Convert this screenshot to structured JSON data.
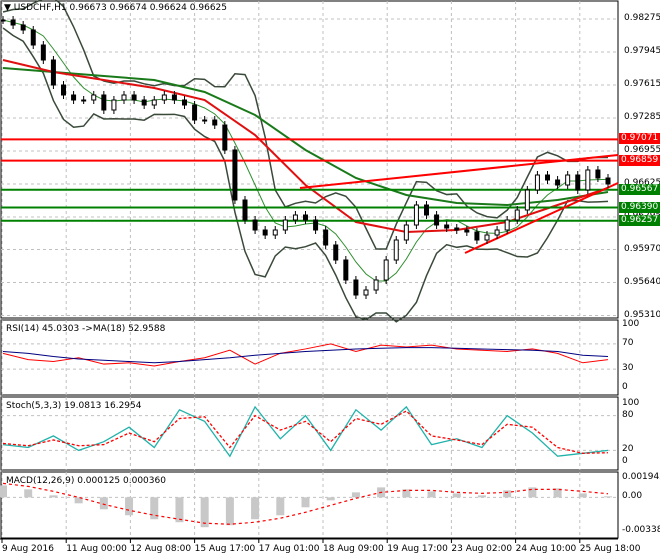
{
  "header": {
    "symbol": "USDCHF,H1",
    "open": "0.96673",
    "high": "0.96674",
    "low": "0.96624",
    "close": "0.96625"
  },
  "chart_data": [
    {
      "type": "candlestick",
      "title": "USDCHF,H1",
      "ylim": [
        0.9531,
        0.98275
      ],
      "yticks": [
        "0.98275",
        "0.97945",
        "0.97615",
        "0.97285",
        "0.96955",
        "0.96625",
        "0.96295",
        "0.95970",
        "0.95640",
        "0.95310"
      ],
      "xticks": [
        "9 Aug 2016",
        "11 Aug 00:00",
        "12 Aug 08:00",
        "15 Aug 17:00",
        "17 Aug 01:00",
        "18 Aug 09:00",
        "19 Aug 17:00",
        "23 Aug 02:00",
        "24 Aug 10:00",
        "25 Aug 18:00"
      ],
      "close": [
        0.98265,
        0.98215,
        0.98165,
        0.98015,
        0.97865,
        0.97615,
        0.97515,
        0.97465,
        0.97465,
        0.97515,
        0.97365,
        0.97465,
        0.97515,
        0.97465,
        0.97415,
        0.97465,
        0.97515,
        0.97465,
        0.97415,
        0.97265,
        0.97265,
        0.97215,
        0.96965,
        0.96465,
        0.96265,
        0.96165,
        0.96115,
        0.96165,
        0.96265,
        0.96315,
        0.96265,
        0.96165,
        0.96015,
        0.95865,
        0.95665,
        0.95515,
        0.95565,
        0.95665,
        0.95865,
        0.96065,
        0.96215,
        0.96415,
        0.96315,
        0.96215,
        0.96185,
        0.96165,
        0.96145,
        0.96065,
        0.96115,
        0.96165,
        0.96265,
        0.96365,
        0.96565,
        0.96715,
        0.96665,
        0.96615,
        0.96715,
        0.96565,
        0.96765,
        0.96685,
        0.96625
      ],
      "ma_red": [
        0.97865,
        0.97745,
        0.97665,
        0.97585,
        0.97465,
        0.97115,
        0.96615,
        0.96245,
        0.96145,
        0.96165,
        0.96245,
        0.96415,
        0.96585
      ],
      "ma_green": [
        0.97785,
        0.97745,
        0.97705,
        0.97665,
        0.97545,
        0.97315,
        0.96965,
        0.96685,
        0.96515,
        0.96435,
        0.96415,
        0.96465,
        0.96545
      ],
      "levels": [
        {
          "value": "0.97071",
          "color": "#ff0000"
        },
        {
          "value": "0.96859",
          "color": "#ff0000"
        },
        {
          "value": "0.96567",
          "color": "#008000"
        },
        {
          "value": "0.96390",
          "color": "#008000"
        },
        {
          "value": "0.96257",
          "color": "#008000"
        }
      ],
      "current_price": "0.96625"
    },
    {
      "type": "line",
      "title": "RSI(14) 45.0303  ->MA(18) 52.9588",
      "ylim": [
        0,
        100
      ],
      "yticks": [
        "100",
        "70",
        "30",
        "0"
      ],
      "series": [
        {
          "color": "#ff0000",
          "values": [
            55,
            45,
            42,
            48,
            38,
            40,
            35,
            42,
            48,
            60,
            38,
            55,
            62,
            70,
            58,
            68,
            65,
            68,
            62,
            60,
            58,
            62,
            55,
            40,
            45
          ]
        },
        {
          "color": "#000080",
          "values": [
            58,
            55,
            50,
            46,
            44,
            42,
            40,
            42,
            45,
            48,
            52,
            55,
            58,
            60,
            62,
            63,
            64,
            64,
            63,
            62,
            61,
            60,
            58,
            52,
            50
          ]
        }
      ]
    },
    {
      "type": "line",
      "title": "Stoch(5,3,3) 19.0813 16.2954",
      "ylim": [
        0,
        100
      ],
      "yticks": [
        "100",
        "80",
        "20",
        "0"
      ],
      "series": [
        {
          "color": "#20b2aa",
          "values": [
            30,
            25,
            45,
            20,
            35,
            60,
            25,
            90,
            70,
            10,
            95,
            40,
            80,
            20,
            90,
            55,
            95,
            30,
            40,
            25,
            80,
            50,
            10,
            15,
            20
          ]
        },
        {
          "color": "#ff0000",
          "dashed": true,
          "values": [
            32,
            28,
            38,
            28,
            30,
            50,
            35,
            75,
            78,
            25,
            80,
            55,
            70,
            35,
            75,
            65,
            88,
            45,
            38,
            30,
            65,
            60,
            25,
            15,
            16
          ]
        }
      ]
    },
    {
      "type": "bar",
      "title": "MACD(12,26,9) 0.000125 0.000360",
      "ylim": [
        -0.003381,
        0.001942
      ],
      "yticks": [
        "0.001942",
        "0.00",
        "-0.003381"
      ],
      "histogram": [
        0.0012,
        0.0008,
        0.0002,
        -0.0006,
        -0.0012,
        -0.0018,
        -0.0022,
        -0.0025,
        -0.003,
        -0.0028,
        -0.0022,
        -0.0018,
        -0.001,
        -0.0003,
        0.0005,
        0.001,
        0.0008,
        0.0006,
        0.0004,
        0.0002,
        0.0007,
        0.001,
        0.0009,
        0.0004,
        0.0001
      ],
      "signal": [
        0.0014,
        0.0011,
        0.0006,
        0.0,
        -0.0007,
        -0.0013,
        -0.0018,
        -0.0022,
        -0.0026,
        -0.0027,
        -0.0025,
        -0.0021,
        -0.0015,
        -0.0008,
        -0.0001,
        0.0005,
        0.0007,
        0.0007,
        0.0005,
        0.0004,
        0.0005,
        0.0008,
        0.0008,
        0.0006,
        0.00036
      ]
    }
  ]
}
